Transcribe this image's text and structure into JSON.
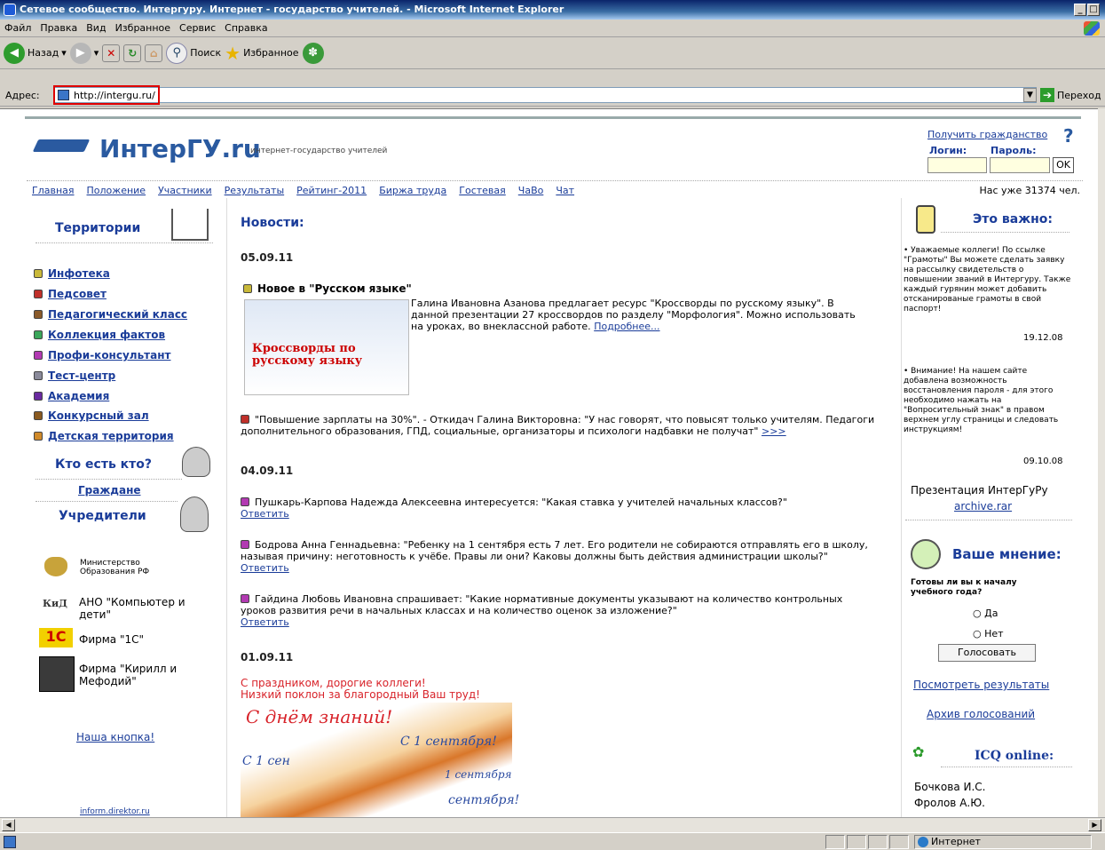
{
  "window": {
    "title": "Сетевое сообщество. Интергуру. Интернет - государство учителей. - Microsoft Internet Explorer"
  },
  "menu": [
    "Файл",
    "Правка",
    "Вид",
    "Избранное",
    "Сервис",
    "Справка"
  ],
  "toolbar": {
    "back": "Назад",
    "search": "Поиск",
    "favorites": "Избранное"
  },
  "address": {
    "label": "Адрес:",
    "url": "http://intergu.ru/",
    "go": "Переход"
  },
  "site": {
    "logo": "ИнтерГУ.ru",
    "tagline": "интернет-государство учителей",
    "get_citizenship": "Получить гражданство",
    "login_label": "Логин:",
    "password_label": "Пароль:",
    "ok": "OK",
    "count_text": "Нас уже 31374 чел."
  },
  "nav": [
    "Главная",
    "Положение",
    "Участники",
    "Результаты",
    "Рейтинг-2011",
    "Биржа труда",
    "Гостевая",
    "ЧаВо",
    "Чат"
  ],
  "left": {
    "territories": "Территории",
    "items": [
      {
        "label": "Инфотека",
        "color": "#c9b93a"
      },
      {
        "label": "Педсовет",
        "color": "#c0302a"
      },
      {
        "label": "Педагогический класс",
        "color": "#8a5a2a"
      },
      {
        "label": "Коллекция фактов",
        "color": "#3aa65a"
      },
      {
        "label": "Профи-консультант",
        "color": "#b23ab2"
      },
      {
        "label": "Тест-центр",
        "color": "#8a8a9a"
      },
      {
        "label": "Академия",
        "color": "#6a2aa0"
      },
      {
        "label": "Конкурсный зал",
        "color": "#8a5a20"
      },
      {
        "label": "Детская территория",
        "color": "#d08a2a"
      }
    ],
    "who": "Кто есть кто?",
    "citizens": "Граждане",
    "founders": "Учредители",
    "partners": [
      "Министерство Образования РФ",
      "АНО \"Компьютер и дети\"",
      "Фирма \"1С\"",
      "Фирма \"Кирилл и Мефодий\""
    ],
    "kid_logo": "КиД",
    "onec_logo": "1С",
    "our_button": "Наша кнопка!",
    "footer_link": "inform.direktor.ru"
  },
  "main": {
    "heading": "Новости:",
    "d1": "05.09.11",
    "n1_title": "Новое в \"Русском языке\"",
    "n1_img": "Кроссворды по русскому языку",
    "n1_text": "Галина Ивановна Азанова предлагает ресурс \"Кроссворды по русскому языку\". В данной презентации 27 кроссвордов по разделу \"Морфология\". Можно использовать на уроках, во внеклассной работе.",
    "n1_more": "Подробнее...",
    "n2_text": "\"Повышение зарплаты на 30%\". - Откидач Галина Викторовна: \"У нас говорят, что повысят только учителям. Педагоги дополнительного образования, ГПД, социальные, организаторы и психологи надбавки не получат\"",
    "n2_more": ">>>",
    "d2": "04.09.11",
    "q1": "Пушкарь-Карпова Надежда Алексеевна интересуется: \"Какая ставка у учителей начальных классов?\"",
    "q2": "Бодрова Анна Геннадьевна: \"Ребенку на 1 сентября есть 7 лет. Его родители не собираются отправлять его в школу, называя причину: неготовность к учёбе. Правы ли они? Каковы должны быть действия администрации школы?\"",
    "q3": "Гайдина Любовь Ивановна спрашивает: \"Какие нормативные документы указывают на количество контрольных уроков развития речи в начальных классах и на количество оценок за изложение?\"",
    "answer": "Ответить",
    "d3": "01.09.11",
    "greet1": "С праздником, дорогие коллеги!",
    "greet2": "Низкий поклон за благородный Ваш труд!",
    "card1": "С днём знаний!",
    "card2": "С 1 сентября!",
    "card3": "С 1 сен",
    "card4": "сентября!",
    "card5": "1 сентября"
  },
  "right": {
    "important": "Это важно:",
    "notice1": "Уважаемые коллеги! По ссылке \"Грамоты\" Вы можете сделать заявку на рассылку свидетельств о повышении званий в Интергуру. Также каждый гурянин может добавить отсканированые грамоты в свой паспорт!",
    "date1": "19.12.08",
    "notice2": "Внимание! На нашем сайте добавлена возможность восстановления пароля - для этого необходимо нажать на \"Вопросительный знак\" в правом верхнем углу страницы и следовать инструкциям!",
    "date2": "09.10.08",
    "presentation": "Презентация ИнтерГуРу",
    "archive": "archive.rar",
    "opinion": "Ваше мнение:",
    "question": "Готовы ли вы к началу учебного года?",
    "yes": "Да",
    "no": "Нет",
    "vote": "Голосовать",
    "results": "Посмотреть результаты",
    "vote_archive": "Архив голосований",
    "icq": "ICQ online:",
    "online": [
      "Бочкова И.С.",
      "Фролов А.Ю."
    ]
  },
  "status": {
    "zone": "Интернет"
  }
}
